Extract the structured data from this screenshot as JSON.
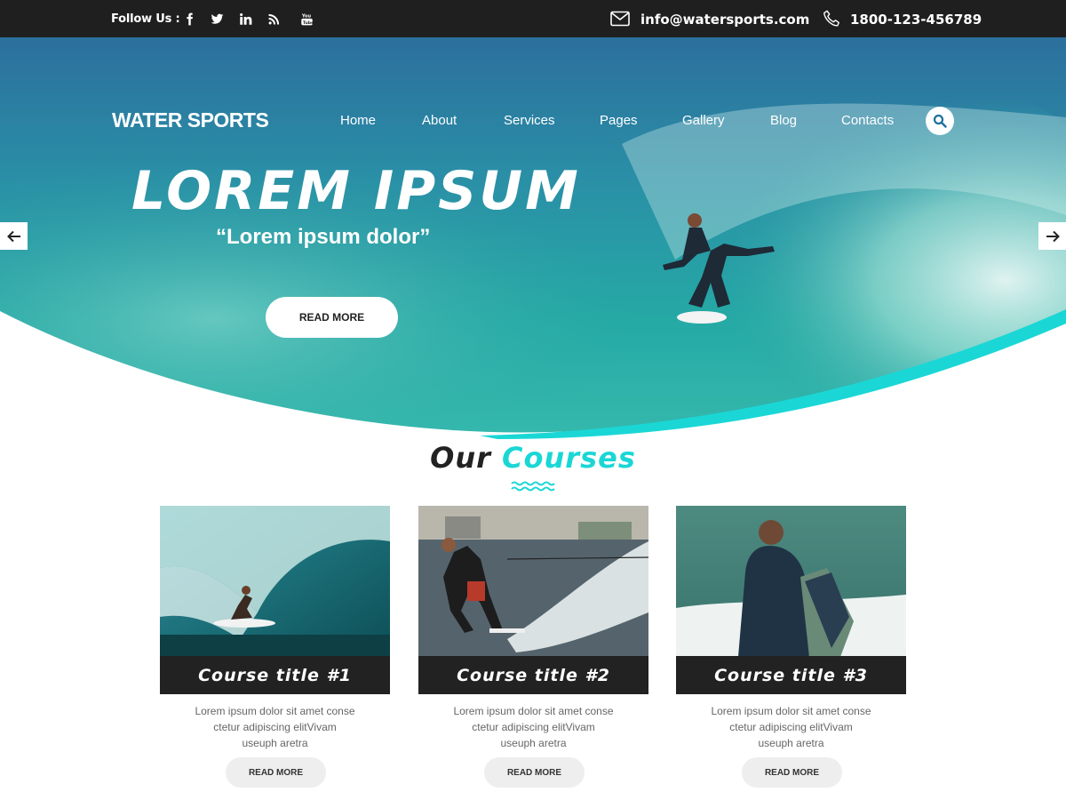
{
  "topbar": {
    "follow_label": "Follow Us :",
    "social_icons": [
      "facebook-icon",
      "twitter-icon",
      "linkedin-icon",
      "rss-icon",
      "youtube-icon"
    ],
    "email": "info@watersports.com",
    "phone": "1800-123-456789"
  },
  "header": {
    "logo": "WATER SPORTS",
    "nav": [
      "Home",
      "About",
      "Services",
      "Pages",
      "Gallery",
      "Blog",
      "Contacts"
    ]
  },
  "hero": {
    "title": "LOREM IPSUM",
    "subtitle": "“Lorem ipsum dolor”",
    "button_label": "READ MORE"
  },
  "courses": {
    "heading_word1": "Our",
    "heading_word2": "Courses",
    "items": [
      {
        "title": "Course title #1",
        "text_line1": "Lorem ipsum dolor sit amet conse",
        "text_line2": "ctetur adipiscing elitVivam",
        "text_line3": "useuph aretra",
        "button_label": "READ MORE"
      },
      {
        "title": "Course title #2",
        "text_line1": "Lorem ipsum dolor sit amet conse",
        "text_line2": "ctetur adipiscing elitVivam",
        "text_line3": "useuph aretra",
        "button_label": "READ MORE"
      },
      {
        "title": "Course title #3",
        "text_line1": "Lorem ipsum dolor sit amet conse",
        "text_line2": "ctetur adipiscing elitVivam",
        "text_line3": "useuph aretra",
        "button_label": "READ MORE"
      }
    ]
  },
  "colors": {
    "accent": "#1ad7d6",
    "topbar_bg": "#1f1f1f",
    "card_title_bg": "#222222"
  }
}
